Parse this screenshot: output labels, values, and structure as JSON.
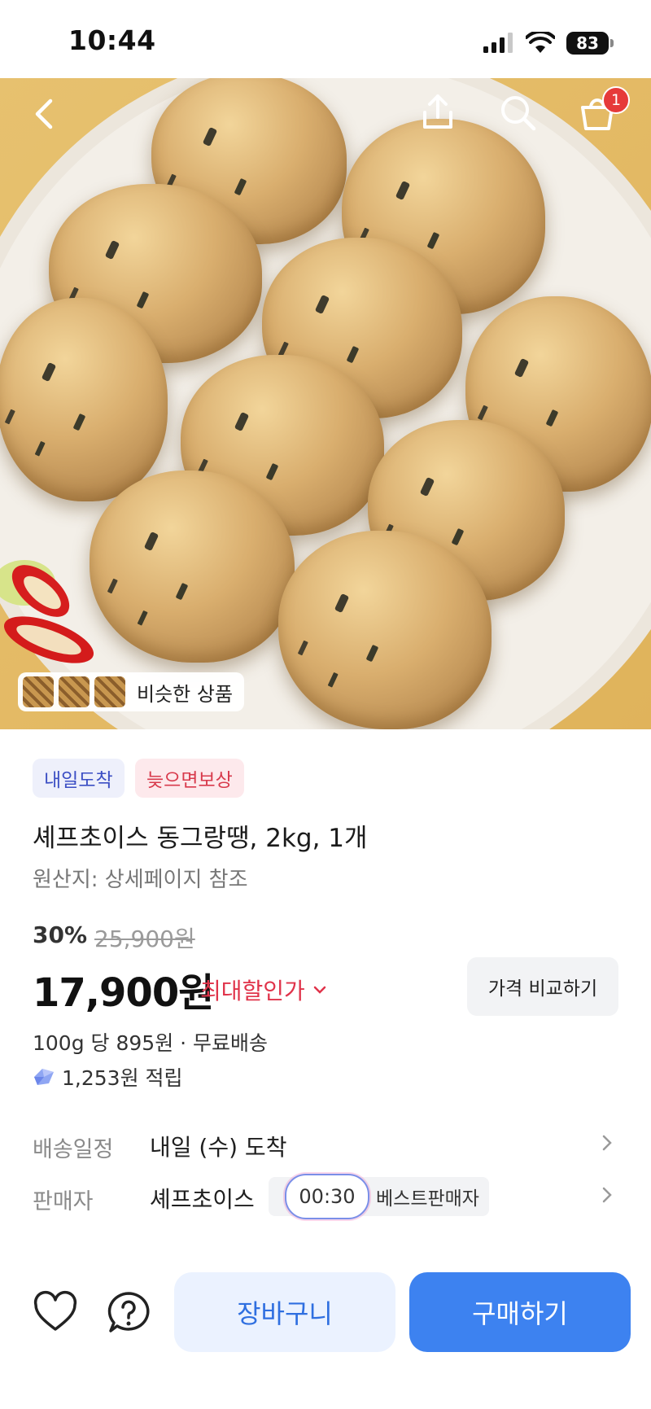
{
  "status_bar": {
    "time": "10:44",
    "battery": "83"
  },
  "nav": {
    "cart_count": "1"
  },
  "similar": {
    "label": "비슷한 상품"
  },
  "tags": {
    "delivery": "내일도착",
    "guarantee": "늦으면보상"
  },
  "product": {
    "title": "셰프초이스 동그랑땡, 2kg, 1개",
    "origin": "원산지: 상세페이지 참조",
    "discount": "30%",
    "original_price": "25,900원",
    "price": "17,900원",
    "max_discount_label": "최대할인가",
    "compare_label": "가격 비교하기",
    "unit_price": "100g 당 895원 · 무료배송",
    "points": "1,253원 적립"
  },
  "shipping": {
    "label": "배송일정",
    "value": "내일 (수) 도착"
  },
  "seller": {
    "label": "판매자",
    "value": "셰프초이스",
    "badge": "베스트판매자",
    "timer": "00:30"
  },
  "bottom": {
    "cart": "장바구니",
    "buy": "구매하기"
  },
  "colors": {
    "accent": "#3d82f0",
    "sale": "#e0334a"
  }
}
